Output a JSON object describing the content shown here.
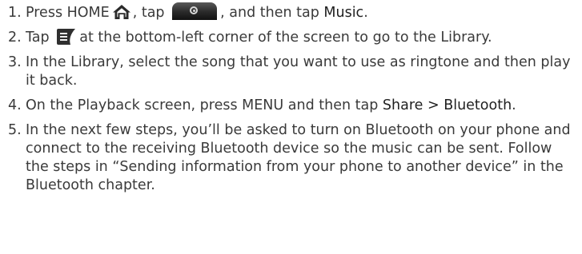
{
  "steps": [
    {
      "number": "1.",
      "parts": {
        "a": "Press HOME",
        "b": ", tap",
        "c": ", and then tap",
        "music": "Music",
        "end": "."
      }
    },
    {
      "number": "2.",
      "parts": {
        "a": "Tap",
        "b": "at the bottom-left corner of the screen to go to the Library."
      }
    },
    {
      "number": "3.",
      "text": "In the Library, select the song that you want to use as ringtone and then play it back."
    },
    {
      "number": "4.",
      "parts": {
        "a": "On the Playback screen, press MENU and then tap",
        "share": "Share >",
        "bluetooth": "Bluetooth",
        "end": "."
      }
    },
    {
      "number": "5.",
      "text": "In the next few steps, you’ll be asked to turn on Bluetooth on your phone and connect to the receiving Bluetooth device so the music can be sent. Follow the steps in “Sending information from your phone to another device” in the Bluetooth chapter."
    }
  ],
  "icons": {
    "home": "home-icon",
    "launcher": "launcher-tab-icon",
    "library": "library-icon"
  }
}
